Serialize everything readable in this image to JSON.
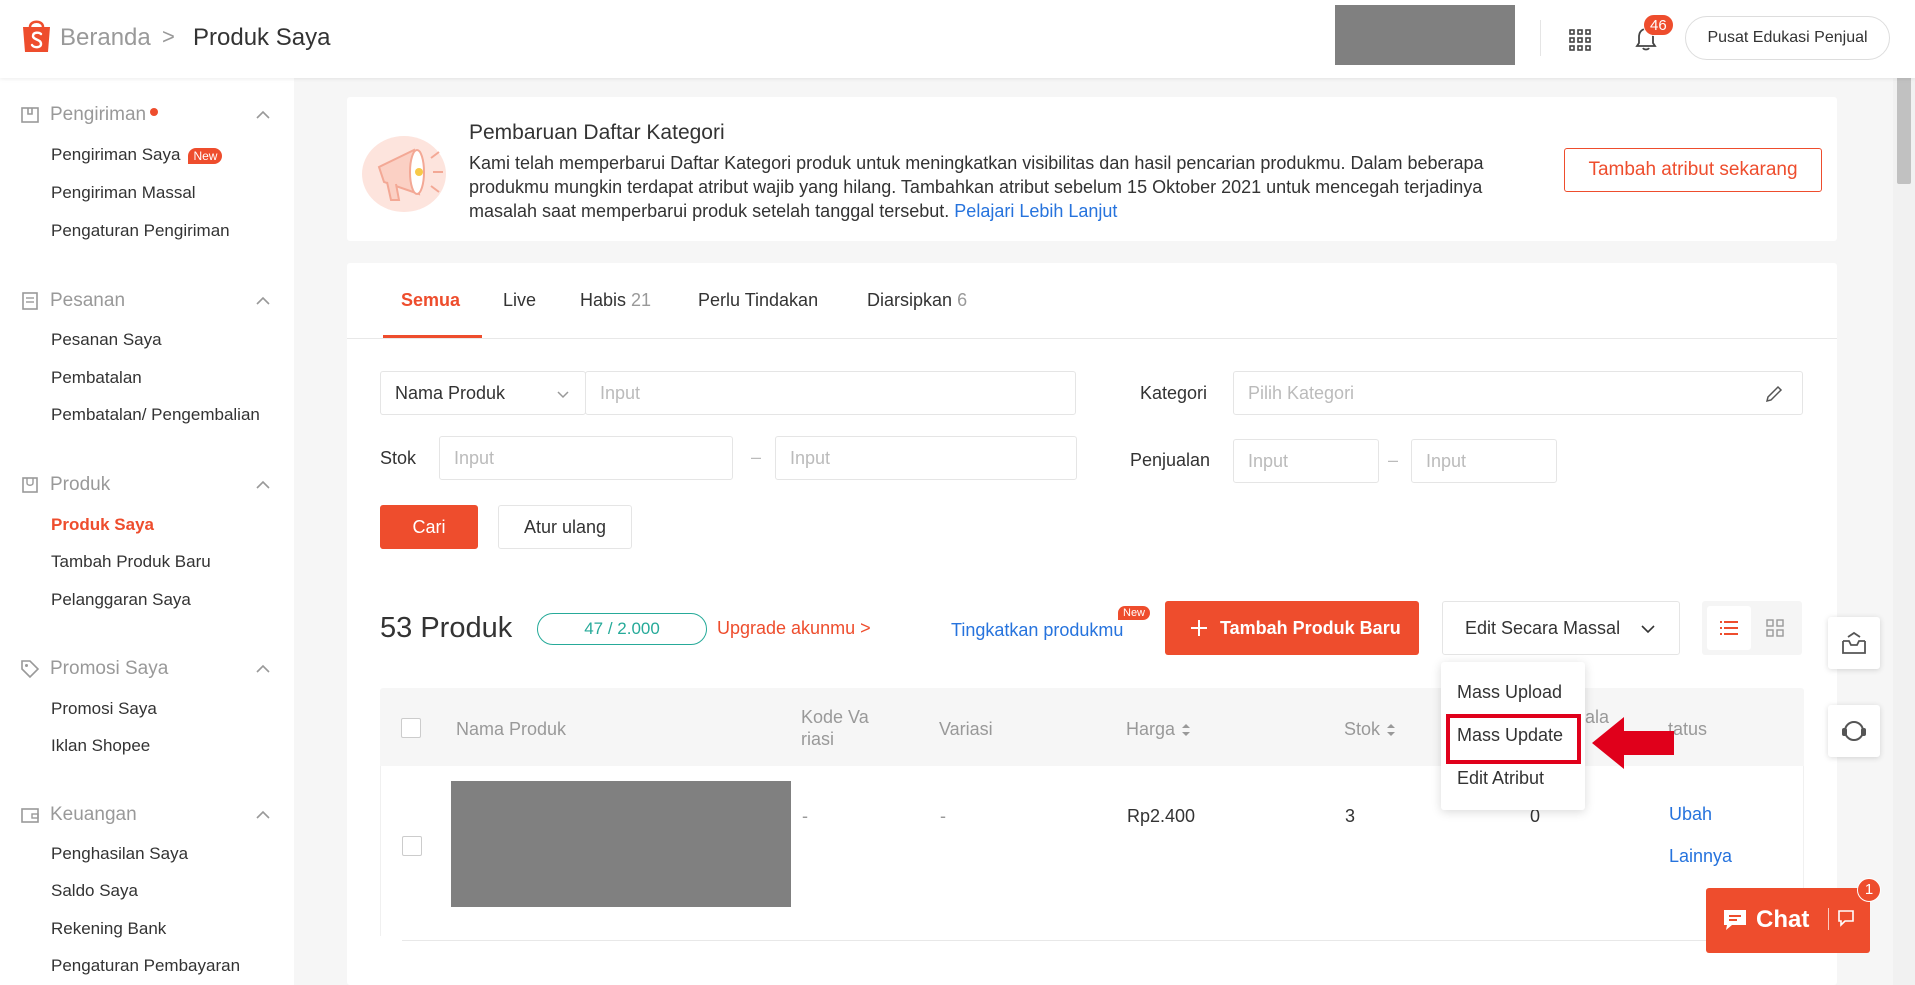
{
  "header": {
    "breadcrumb_home": "Beranda",
    "breadcrumb_sep": ">",
    "breadcrumb_current": "Produk Saya",
    "notification_count": "46",
    "edu_button": "Pusat Edukasi Penjual"
  },
  "sidebar": {
    "sections": [
      {
        "title": "Pengiriman",
        "items": [
          "Pengiriman Saya",
          "Pengiriman Massal",
          "Pengaturan Pengiriman"
        ],
        "item_badge": "New"
      },
      {
        "title": "Pesanan",
        "items": [
          "Pesanan Saya",
          "Pembatalan",
          "Pembatalan/ Pengembalian"
        ]
      },
      {
        "title": "Produk",
        "items": [
          "Produk Saya",
          "Tambah Produk Baru",
          "Pelanggaran Saya"
        ]
      },
      {
        "title": "Promosi Saya",
        "items": [
          "Promosi Saya",
          "Iklan Shopee"
        ]
      },
      {
        "title": "Keuangan",
        "items": [
          "Penghasilan Saya",
          "Saldo Saya",
          "Rekening Bank",
          "Pengaturan Pembayaran"
        ]
      }
    ]
  },
  "banner": {
    "title": "Pembaruan Daftar Kategori",
    "text": "Kami telah memperbarui Daftar Kategori produk untuk meningkatkan visibilitas dan hasil pencarian produkmu. Dalam beberapa produkmu mungkin terdapat atribut wajib yang hilang. Tambahkan atribut sebelum 15 Oktober 2021 untuk mencegah terjadinya masalah saat memperbarui produk setelah tanggal tersebut.",
    "link": "Pelajari Lebih Lanjut",
    "button": "Tambah atribut sekarang"
  },
  "tabs": [
    {
      "label": "Semua",
      "count": ""
    },
    {
      "label": "Live",
      "count": ""
    },
    {
      "label": "Habis",
      "count": "21"
    },
    {
      "label": "Perlu Tindakan",
      "count": ""
    },
    {
      "label": "Diarsipkan",
      "count": "6"
    }
  ],
  "filters": {
    "name_select": "Nama Produk",
    "input_placeholder": "Input",
    "kategori_label": "Kategori",
    "kategori_placeholder": "Pilih Kategori",
    "stok_label": "Stok",
    "penjualan_label": "Penjualan",
    "range_sep": "–",
    "search_button": "Cari",
    "reset_button": "Atur ulang"
  },
  "toolbar": {
    "product_count": "53 Produk",
    "quota": "47 / 2.000",
    "upgrade_link": "Upgrade akunmu >",
    "improve_link": "Tingkatkan produkmu",
    "improve_badge": "New",
    "add_button": "Tambah Produk Baru",
    "mass_edit_button": "Edit Secara Massal"
  },
  "mass_menu": [
    "Mass Upload",
    "Mass Update",
    "Edit Atribut"
  ],
  "table": {
    "headers": {
      "name": "Nama Produk",
      "sku_line1": "Kode Va",
      "sku_line2": "riasi",
      "variation": "Variasi",
      "price": "Harga",
      "stock": "Stok",
      "sales_partial": "ala",
      "status_partial": "tatus"
    },
    "rows": [
      {
        "sku": "-",
        "variation": "-",
        "price": "Rp2.400",
        "stock": "3",
        "sales": "0",
        "action_edit": "Ubah",
        "action_more": "Lainnya"
      }
    ]
  },
  "chat": {
    "label": "Chat",
    "badge": "1"
  },
  "colors": {
    "brand": "#ee4d2d",
    "link": "#2673dd",
    "teal": "#26aa99",
    "highlight": "#e0001b"
  }
}
